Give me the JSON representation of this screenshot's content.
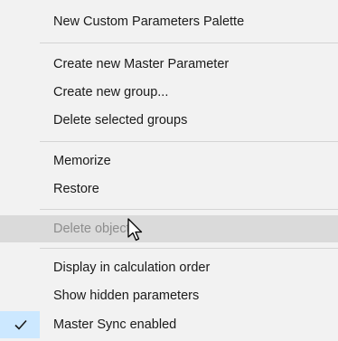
{
  "menu": {
    "items": [
      {
        "label": "New Custom Parameters Palette",
        "enabled": true
      },
      {
        "label": "Create new Master Parameter",
        "enabled": true
      },
      {
        "label": "Create new group...",
        "enabled": true
      },
      {
        "label": "Delete selected groups",
        "enabled": true
      },
      {
        "label": "Memorize",
        "enabled": true
      },
      {
        "label": "Restore",
        "enabled": true
      },
      {
        "label": "Delete object",
        "enabled": false,
        "hovered": true
      },
      {
        "label": "Display in calculation order",
        "enabled": true
      },
      {
        "label": "Show hidden parameters",
        "enabled": true
      },
      {
        "label": "Master Sync enabled",
        "enabled": true,
        "checked": true
      }
    ]
  },
  "colors": {
    "menu_background": "#f2f2f2",
    "hover_background": "#dadada",
    "check_background": "#cce8ff",
    "check_mark": "#1a1a1a",
    "disabled_text": "#8d8d8d",
    "separator": "#d4d4d4"
  },
  "icons": {
    "check": "checkmark-icon",
    "cursor": "mouse-pointer-icon"
  }
}
